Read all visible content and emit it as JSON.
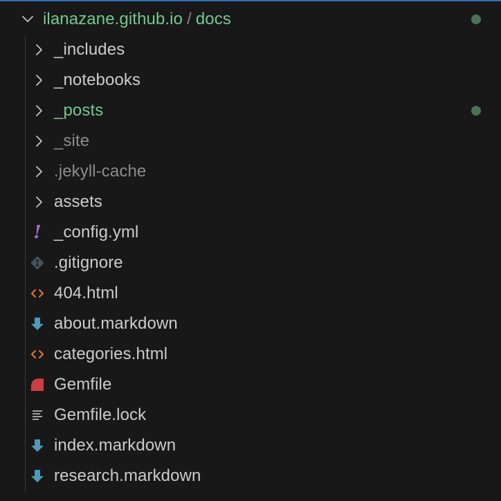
{
  "root": {
    "parent": "ilanazane.github.io",
    "separator": "/",
    "folder": "docs",
    "status": "modified"
  },
  "colors": {
    "accent_border": "#2f6fb3",
    "background": "#181818",
    "text_default": "#cccccc",
    "text_modified": "#73c991",
    "text_ignored": "#8c8c8c",
    "git_dot": "#4b7157",
    "icon_chevron": "#c5c5c5",
    "icon_yml": "#a074c4",
    "icon_git": "#41535b",
    "icon_html": "#e37933",
    "icon_markdown": "#519aba",
    "icon_ruby": "#cc3e44"
  },
  "items": [
    {
      "label": "_includes",
      "kind": "folder",
      "icon": "chevron-right-icon",
      "state": "default"
    },
    {
      "label": "_notebooks",
      "kind": "folder",
      "icon": "chevron-right-icon",
      "state": "default"
    },
    {
      "label": "_posts",
      "kind": "folder",
      "icon": "chevron-right-icon",
      "state": "modified"
    },
    {
      "label": "_site",
      "kind": "folder",
      "icon": "chevron-right-icon",
      "state": "ignored"
    },
    {
      "label": ".jekyll-cache",
      "kind": "folder",
      "icon": "chevron-right-icon",
      "state": "ignored"
    },
    {
      "label": "assets",
      "kind": "folder",
      "icon": "chevron-right-icon",
      "state": "default"
    },
    {
      "label": "_config.yml",
      "kind": "file",
      "icon": "yaml-icon",
      "state": "default"
    },
    {
      "label": ".gitignore",
      "kind": "file",
      "icon": "git-icon",
      "state": "default"
    },
    {
      "label": "404.html",
      "kind": "file",
      "icon": "html-icon",
      "state": "default"
    },
    {
      "label": "about.markdown",
      "kind": "file",
      "icon": "markdown-icon",
      "state": "default"
    },
    {
      "label": "categories.html",
      "kind": "file",
      "icon": "html-icon",
      "state": "default"
    },
    {
      "label": "Gemfile",
      "kind": "file",
      "icon": "ruby-gem-icon",
      "state": "default"
    },
    {
      "label": "Gemfile.lock",
      "kind": "file",
      "icon": "lines-icon",
      "state": "default"
    },
    {
      "label": "index.markdown",
      "kind": "file",
      "icon": "markdown-icon",
      "state": "default"
    },
    {
      "label": "research.markdown",
      "kind": "file",
      "icon": "markdown-icon",
      "state": "default"
    }
  ]
}
